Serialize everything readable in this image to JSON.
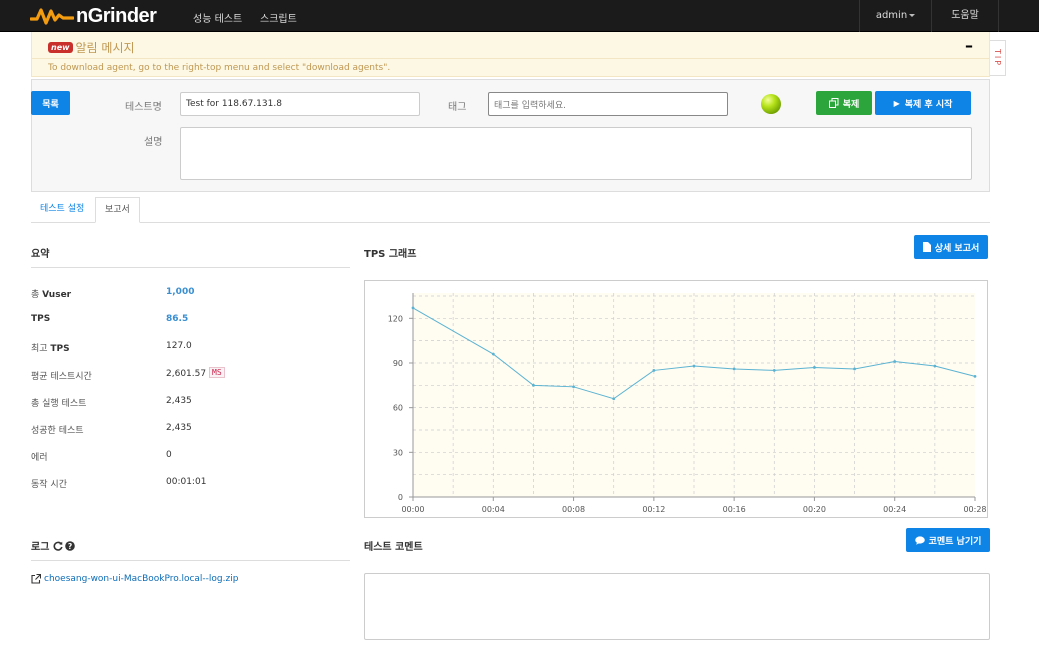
{
  "navbar": {
    "logo_text": "nGrinder",
    "links": [
      "성능 테스트",
      "스크립트"
    ],
    "user": "admin",
    "help": "도움말"
  },
  "alert": {
    "badge": "new",
    "title": "알림 메시지",
    "message": "To download agent, go to the right-top menu and select \"download agents\".",
    "minimize": "–",
    "tip": "TIP"
  },
  "form": {
    "list_button": "목록",
    "test_name_label": "테스트명",
    "test_name_value": "Test for 118.67.131.8",
    "tag_label": "태그",
    "tag_placeholder": "태그를 입력하세요.",
    "clone_button": "복제",
    "clone_start_button": "복제 후 시작",
    "description_label": "설명",
    "description_value": ""
  },
  "tabs": [
    {
      "label": "테스트 설정",
      "active": false
    },
    {
      "label": "보고서",
      "active": true
    }
  ],
  "summary": {
    "title": "요약",
    "rows": [
      {
        "prefix": "총 ",
        "bold": "Vuser",
        "value": "1,000",
        "link": true
      },
      {
        "prefix": "",
        "bold": "TPS",
        "value": "86.5",
        "link": true
      },
      {
        "prefix": "최고 ",
        "bold": "TPS",
        "value": "127.0",
        "link": false
      },
      {
        "prefix": "평균 테스트시간",
        "bold": "",
        "value": "2,601.57",
        "link": false
      },
      {
        "prefix": "총 실행 테스트",
        "bold": "",
        "value": "2,435",
        "link": false
      },
      {
        "prefix": "성공한 테스트",
        "bold": "",
        "value": "2,435",
        "link": false
      },
      {
        "prefix": "에러",
        "bold": "",
        "value": "0",
        "link": false
      },
      {
        "prefix": "동작 시간",
        "bold": "",
        "value": "00:01:01",
        "link": false
      }
    ],
    "unit_badge": "MS"
  },
  "tps": {
    "title": "TPS 그래프",
    "detail_button": "상세 보고서"
  },
  "chart_data": {
    "type": "line",
    "title": "",
    "xlabel": "",
    "ylabel": "",
    "x_ticks": [
      "00:00",
      "00:04",
      "00:08",
      "00:12",
      "00:16",
      "00:20",
      "00:24",
      "00:28"
    ],
    "y_ticks": [
      0,
      30,
      60,
      90,
      120
    ],
    "ylim": [
      0,
      137
    ],
    "xlim": [
      0,
      28
    ],
    "x": [
      0,
      4,
      6,
      8,
      10,
      12,
      14,
      16,
      18,
      20,
      22,
      24,
      26,
      28
    ],
    "values": [
      127,
      96,
      75,
      74,
      66,
      85,
      88,
      86,
      85,
      87,
      86,
      91,
      88,
      81
    ],
    "grid": true,
    "colors": {
      "line": "#5bb3d1",
      "plot_bg": "#fffcf2",
      "grid": "#cccccc"
    }
  },
  "log": {
    "title": "로그",
    "file": "choesang-won-ui-MacBookPro.local--log.zip"
  },
  "comment": {
    "title": "테스트 코멘트",
    "button": "코멘트 남기기",
    "value": ""
  },
  "colors": {
    "primary": "#0d84e6",
    "success": "#2ca63c",
    "navbar": "#1b1b1b",
    "logo_orange": "#f39c12"
  }
}
